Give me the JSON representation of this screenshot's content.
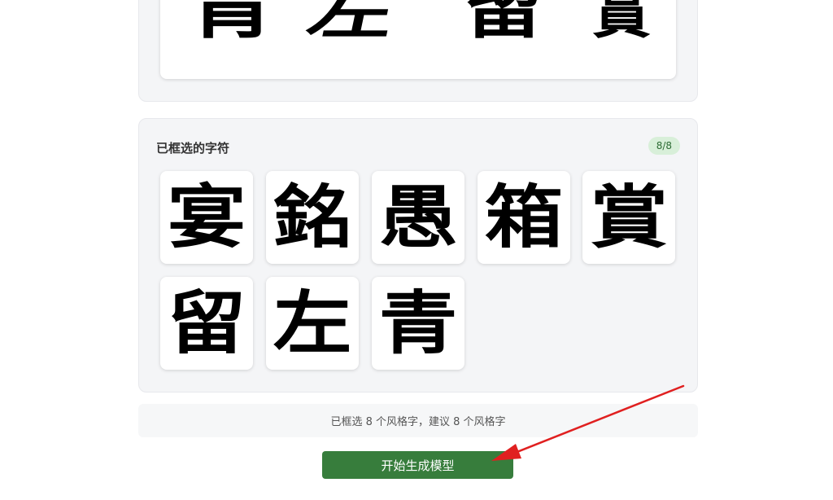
{
  "preview": {
    "characters": [
      "青",
      "左",
      "留",
      "賞"
    ]
  },
  "selected": {
    "title": "已框选的字符",
    "count_badge": "8/8",
    "characters": [
      "宴",
      "銘",
      "愚",
      "箱",
      "賞",
      "留",
      "左",
      "青"
    ]
  },
  "status": {
    "text": "已框选 8 个风格字，建议 8 个风格字"
  },
  "actions": {
    "generate_label": "开始生成模型"
  },
  "annotation": {
    "arrow_color": "#e02020"
  },
  "colors": {
    "primary": "#377d3c",
    "badge_bg": "#d8efd9",
    "badge_text": "#2c6b33",
    "panel_bg": "#f4f5f7"
  }
}
